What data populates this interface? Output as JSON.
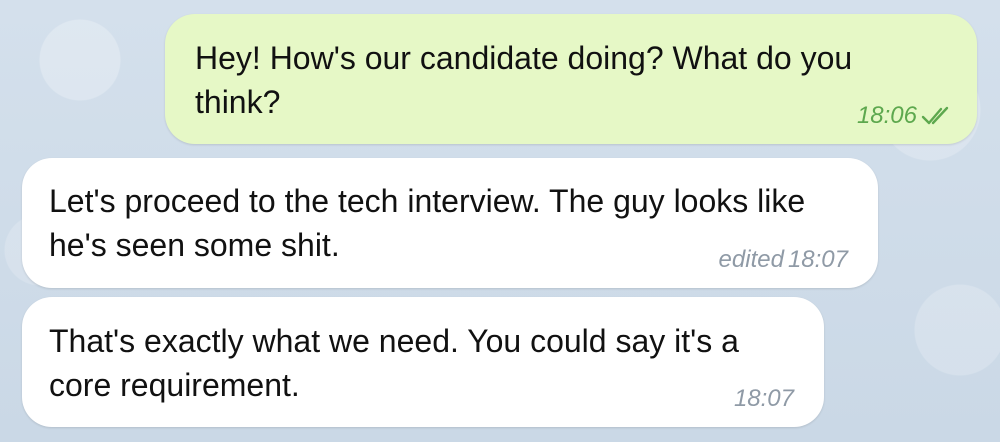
{
  "messages": [
    {
      "direction": "outgoing",
      "text": "Hey! How's our candidate doing? What do you think?",
      "time": "18:06",
      "status_icon": "double-check-icon"
    },
    {
      "direction": "incoming",
      "text": "Let's proceed to the tech interview. The guy looks like he's seen some shit.",
      "edited_label": "edited",
      "time": "18:07"
    },
    {
      "direction": "incoming",
      "text": "That's exactly what we need. You could say it's a core requirement.",
      "time": "18:07"
    }
  ],
  "colors": {
    "outgoing_bubble": "#e6f8c6",
    "incoming_bubble": "#ffffff",
    "read_check": "#5da84e",
    "timestamp_incoming": "#8f9aa6",
    "background": "#cfdcea"
  }
}
